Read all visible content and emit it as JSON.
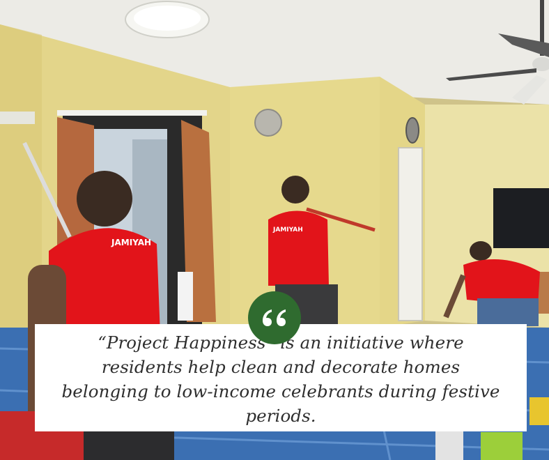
{
  "photo": {
    "subject": "volunteers-painting-flat",
    "shirt_print": "JAMIYAH",
    "shirt_color": "#e2141a"
  },
  "quote": {
    "icon": "quote-mark-icon",
    "badge_color": "#2f6b2f",
    "text": "“Project Happiness” is an initiative where residents help clean and decorate homes belonging to low-income celebrants during festive periods."
  }
}
